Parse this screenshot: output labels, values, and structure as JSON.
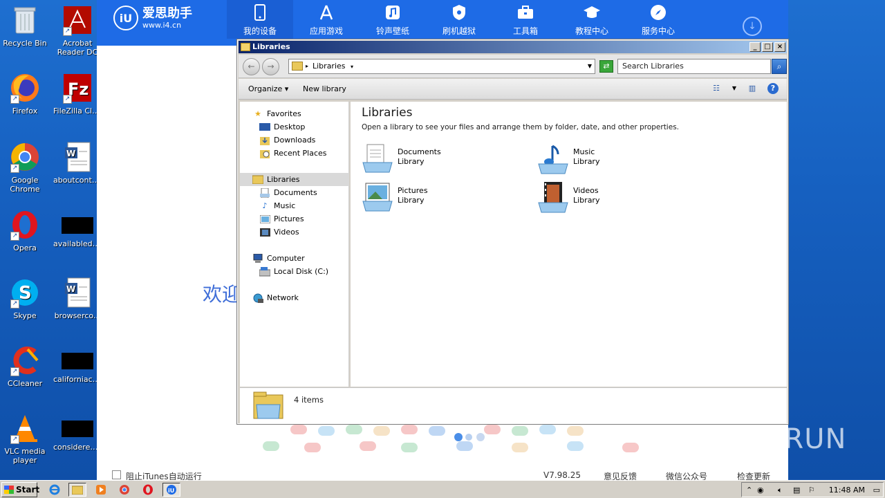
{
  "desktop": {
    "icons": [
      {
        "label": "Recycle Bin"
      },
      {
        "label": "Acrobat Reader DC"
      },
      {
        "label": "Firefox"
      },
      {
        "label": "FileZilla Client"
      },
      {
        "label": "Google Chrome"
      },
      {
        "label": "aboutconte..."
      },
      {
        "label": "Opera"
      },
      {
        "label": "availabledir..."
      },
      {
        "label": "Skype"
      },
      {
        "label": "browserco..."
      },
      {
        "label": "CCleaner"
      },
      {
        "label": "californiaco..."
      },
      {
        "label": "VLC media player"
      },
      {
        "label": "considerede..."
      }
    ]
  },
  "i4": {
    "logo_title": "爱思助手",
    "logo_url": "www.i4.cn",
    "nav": [
      {
        "label": "我的设备"
      },
      {
        "label": "应用游戏"
      },
      {
        "label": "铃声壁纸"
      },
      {
        "label": "刷机越狱"
      },
      {
        "label": "工具箱"
      },
      {
        "label": "教程中心"
      },
      {
        "label": "服务中心"
      }
    ],
    "welcome": "欢迎",
    "itunes_checkbox": "阻止iTunes自动运行",
    "version": "V7.98.25",
    "feedback": "意见反馈",
    "wechat": "微信公众号",
    "update": "检查更新"
  },
  "explorer": {
    "title": "Libraries",
    "address": "Libraries",
    "search_placeholder": "Search Libraries",
    "organize": "Organize",
    "new_library": "New library",
    "nav": {
      "favorites": "Favorites",
      "desktop": "Desktop",
      "downloads": "Downloads",
      "recent": "Recent Places",
      "libraries": "Libraries",
      "documents": "Documents",
      "music": "Music",
      "pictures": "Pictures",
      "videos": "Videos",
      "computer": "Computer",
      "localdisk": "Local Disk (C:)",
      "network": "Network"
    },
    "heading": "Libraries",
    "subheading": "Open a library to see your files and arrange them by folder, date, and other properties.",
    "libraries": [
      {
        "name": "Documents",
        "type": "Library"
      },
      {
        "name": "Music",
        "type": "Library"
      },
      {
        "name": "Pictures",
        "type": "Library"
      },
      {
        "name": "Videos",
        "type": "Library"
      }
    ],
    "status": "4 items"
  },
  "taskbar": {
    "start": "Start",
    "clock": "11:48 AM"
  },
  "watermark": "ANY RUN"
}
